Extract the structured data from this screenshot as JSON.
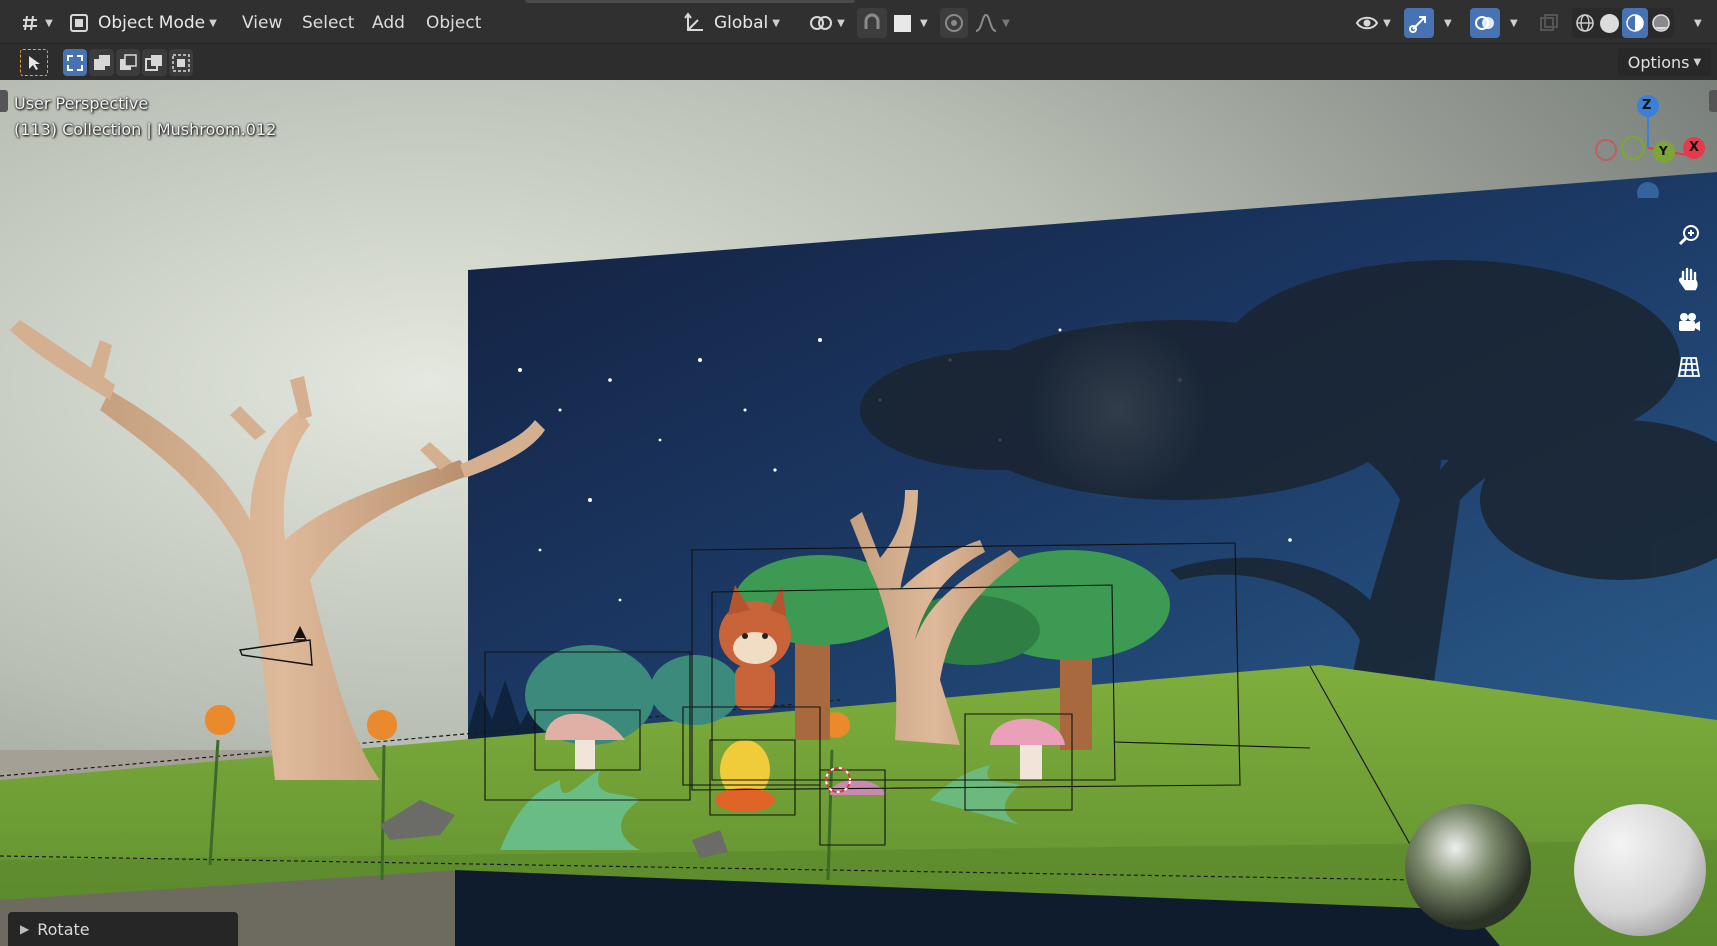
{
  "header": {
    "editor_type_icon": "grid-view3d-icon",
    "mode_label": "Object Mode",
    "menus": [
      "View",
      "Select",
      "Add",
      "Object"
    ],
    "transform_orientation": "Global",
    "pivot_icon": "snap-link-icon",
    "snap_icon": "magnet-icon",
    "proportional_icon": "proportional-edit-icon",
    "falloff_icon": "falloff-curve-icon",
    "visibility_icon": "eye-icon",
    "gizmo_icon": "gizmo-icon",
    "overlay_icon": "overlay-icon",
    "xray_icon": "xray-icon",
    "shading_modes": [
      "wireframe-icon",
      "solid-icon",
      "material-preview-icon",
      "rendered-icon"
    ],
    "active_shading": "material-preview-icon",
    "accent_color": "#4772b3"
  },
  "toolrow": {
    "tool_icons": [
      "cursor-select-icon",
      "select-box-new-icon",
      "select-extend-icon",
      "select-subtract-icon",
      "select-invert-icon",
      "select-intersect-icon"
    ],
    "options_label": "Options"
  },
  "viewport": {
    "view_name": "User Perspective",
    "collection_info": "(113) Collection | Mushroom.012",
    "axes": {
      "z": "Z",
      "y": "Y",
      "x": "X"
    },
    "axis_colors": {
      "x": "#e63a4a",
      "y": "#7ea53a",
      "z": "#3a80d9"
    },
    "nav_buttons": [
      "zoom-icon",
      "hand-pan-icon",
      "camera-icon",
      "ortho-grid-icon"
    ]
  },
  "last_operator": {
    "label": "Rotate"
  }
}
